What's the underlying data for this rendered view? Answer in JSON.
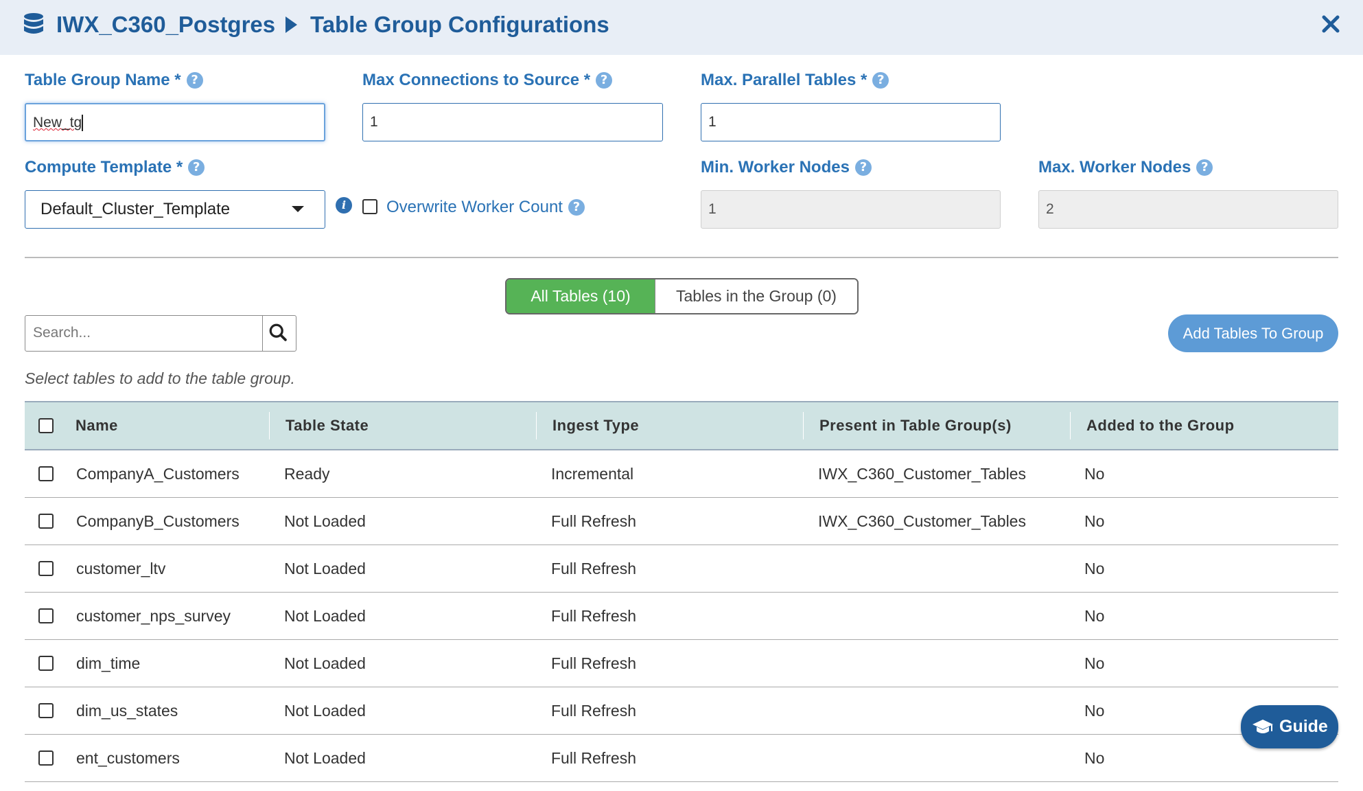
{
  "header": {
    "app_name": "IWX_C360_Postgres",
    "page_title": "Table Group Configurations"
  },
  "form": {
    "table_group_name": {
      "label": "Table Group Name *",
      "value": "New_tg"
    },
    "max_connections": {
      "label": "Max Connections to Source *",
      "value": "1"
    },
    "max_parallel_tables": {
      "label": "Max. Parallel Tables *",
      "value": "1"
    },
    "compute_template": {
      "label": "Compute Template *",
      "selected": "Default_Cluster_Template"
    },
    "overwrite_worker_count": {
      "label": "Overwrite Worker Count",
      "checked": false
    },
    "min_worker_nodes": {
      "label": "Min. Worker Nodes",
      "value": "1"
    },
    "max_worker_nodes": {
      "label": "Max. Worker Nodes",
      "value": "2"
    }
  },
  "tabs": [
    {
      "label": "All Tables (10)",
      "active": true
    },
    {
      "label": "Tables in the Group (0)",
      "active": false
    }
  ],
  "search": {
    "placeholder": "Search..."
  },
  "actions": {
    "add_tables_label": "Add Tables To Group"
  },
  "hint": "Select tables to add to the table group.",
  "table": {
    "columns": [
      "Name",
      "Table State",
      "Ingest Type",
      "Present in Table Group(s)",
      "Added to the Group"
    ],
    "rows": [
      {
        "name": "CompanyA_Customers",
        "state": "Ready",
        "ingest": "Incremental",
        "groups": "IWX_C360_Customer_Tables",
        "added": "No"
      },
      {
        "name": "CompanyB_Customers",
        "state": "Not Loaded",
        "ingest": "Full Refresh",
        "groups": "IWX_C360_Customer_Tables",
        "added": "No"
      },
      {
        "name": "customer_ltv",
        "state": "Not Loaded",
        "ingest": "Full Refresh",
        "groups": "",
        "added": "No"
      },
      {
        "name": "customer_nps_survey",
        "state": "Not Loaded",
        "ingest": "Full Refresh",
        "groups": "",
        "added": "No"
      },
      {
        "name": "dim_time",
        "state": "Not Loaded",
        "ingest": "Full Refresh",
        "groups": "",
        "added": "No"
      },
      {
        "name": "dim_us_states",
        "state": "Not Loaded",
        "ingest": "Full Refresh",
        "groups": "",
        "added": "No"
      },
      {
        "name": "ent_customers",
        "state": "Not Loaded",
        "ingest": "Full Refresh",
        "groups": "",
        "added": "No"
      }
    ]
  },
  "guide": {
    "label": "Guide"
  },
  "icons": {
    "header": "database-icon",
    "close": "close-icon",
    "help": "question-circle-icon",
    "info": "info-circle-icon",
    "search": "search-icon",
    "guide": "graduation-cap-icon"
  },
  "colors": {
    "primary": "#1f5c99",
    "label": "#2a72b5",
    "active_tab": "#56b356",
    "add_button": "#5d9bd6",
    "table_header": "#cfe3e3"
  }
}
